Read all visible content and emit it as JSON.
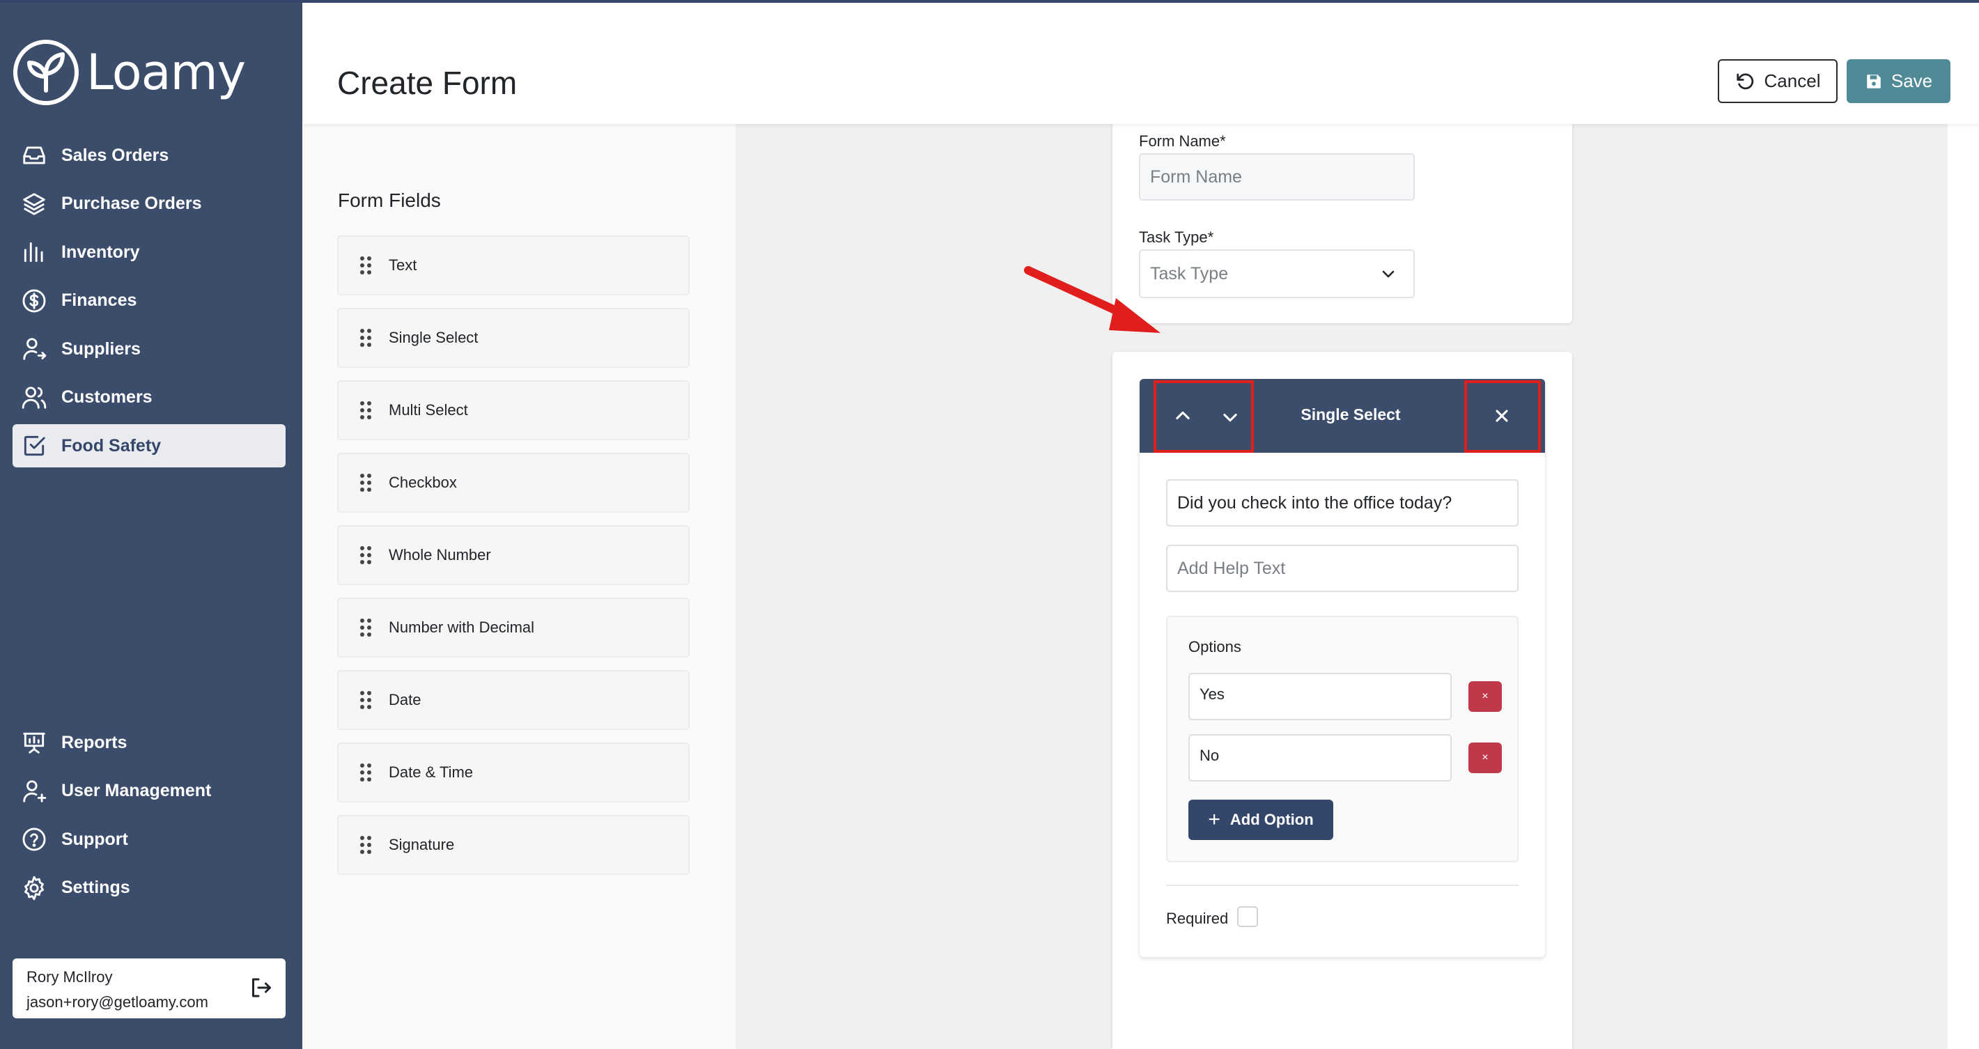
{
  "app": {
    "brand": "Loamy"
  },
  "sidebar": {
    "top_items": [
      {
        "label": "Sales Orders",
        "icon": "inbox-icon"
      },
      {
        "label": "Purchase Orders",
        "icon": "layers-icon"
      },
      {
        "label": "Inventory",
        "icon": "bar-chart-icon"
      },
      {
        "label": "Finances",
        "icon": "dollar-circle-icon"
      },
      {
        "label": "Suppliers",
        "icon": "user-arrow-icon"
      },
      {
        "label": "Customers",
        "icon": "users-icon"
      },
      {
        "label": "Food Safety",
        "icon": "checkbox-icon",
        "active": true
      }
    ],
    "bottom_items": [
      {
        "label": "Reports",
        "icon": "presentation-icon"
      },
      {
        "label": "User Management",
        "icon": "user-plus-icon"
      },
      {
        "label": "Support",
        "icon": "help-circle-icon"
      },
      {
        "label": "Settings",
        "icon": "gear-icon"
      }
    ],
    "user": {
      "name": "Rory McIlroy",
      "email": "jason+rory@getloamy.com"
    }
  },
  "header": {
    "title": "Create Form",
    "cancel_label": "Cancel",
    "save_label": "Save"
  },
  "form_fields": {
    "title": "Form Fields",
    "items": [
      "Text",
      "Single Select",
      "Multi Select",
      "Checkbox",
      "Whole Number",
      "Number with Decimal",
      "Date",
      "Date & Time",
      "Signature"
    ]
  },
  "form_meta": {
    "name_label": "Form Name*",
    "name_placeholder": "Form Name",
    "task_type_label": "Task Type*",
    "task_type_placeholder": "Task Type"
  },
  "field_card": {
    "title": "Single Select",
    "question_value": "Did you check into the office today?",
    "help_placeholder": "Add Help Text",
    "options_title": "Options",
    "options": [
      "Yes",
      "No"
    ],
    "delete_symbol": "×",
    "add_option_label": "Add Option",
    "required_label": "Required",
    "required_checked": false
  },
  "colors": {
    "sidebar": "#3b4d6b",
    "save_button": "#4f8a96",
    "delete_button": "#c0394b",
    "highlight": "#e01e1e"
  }
}
